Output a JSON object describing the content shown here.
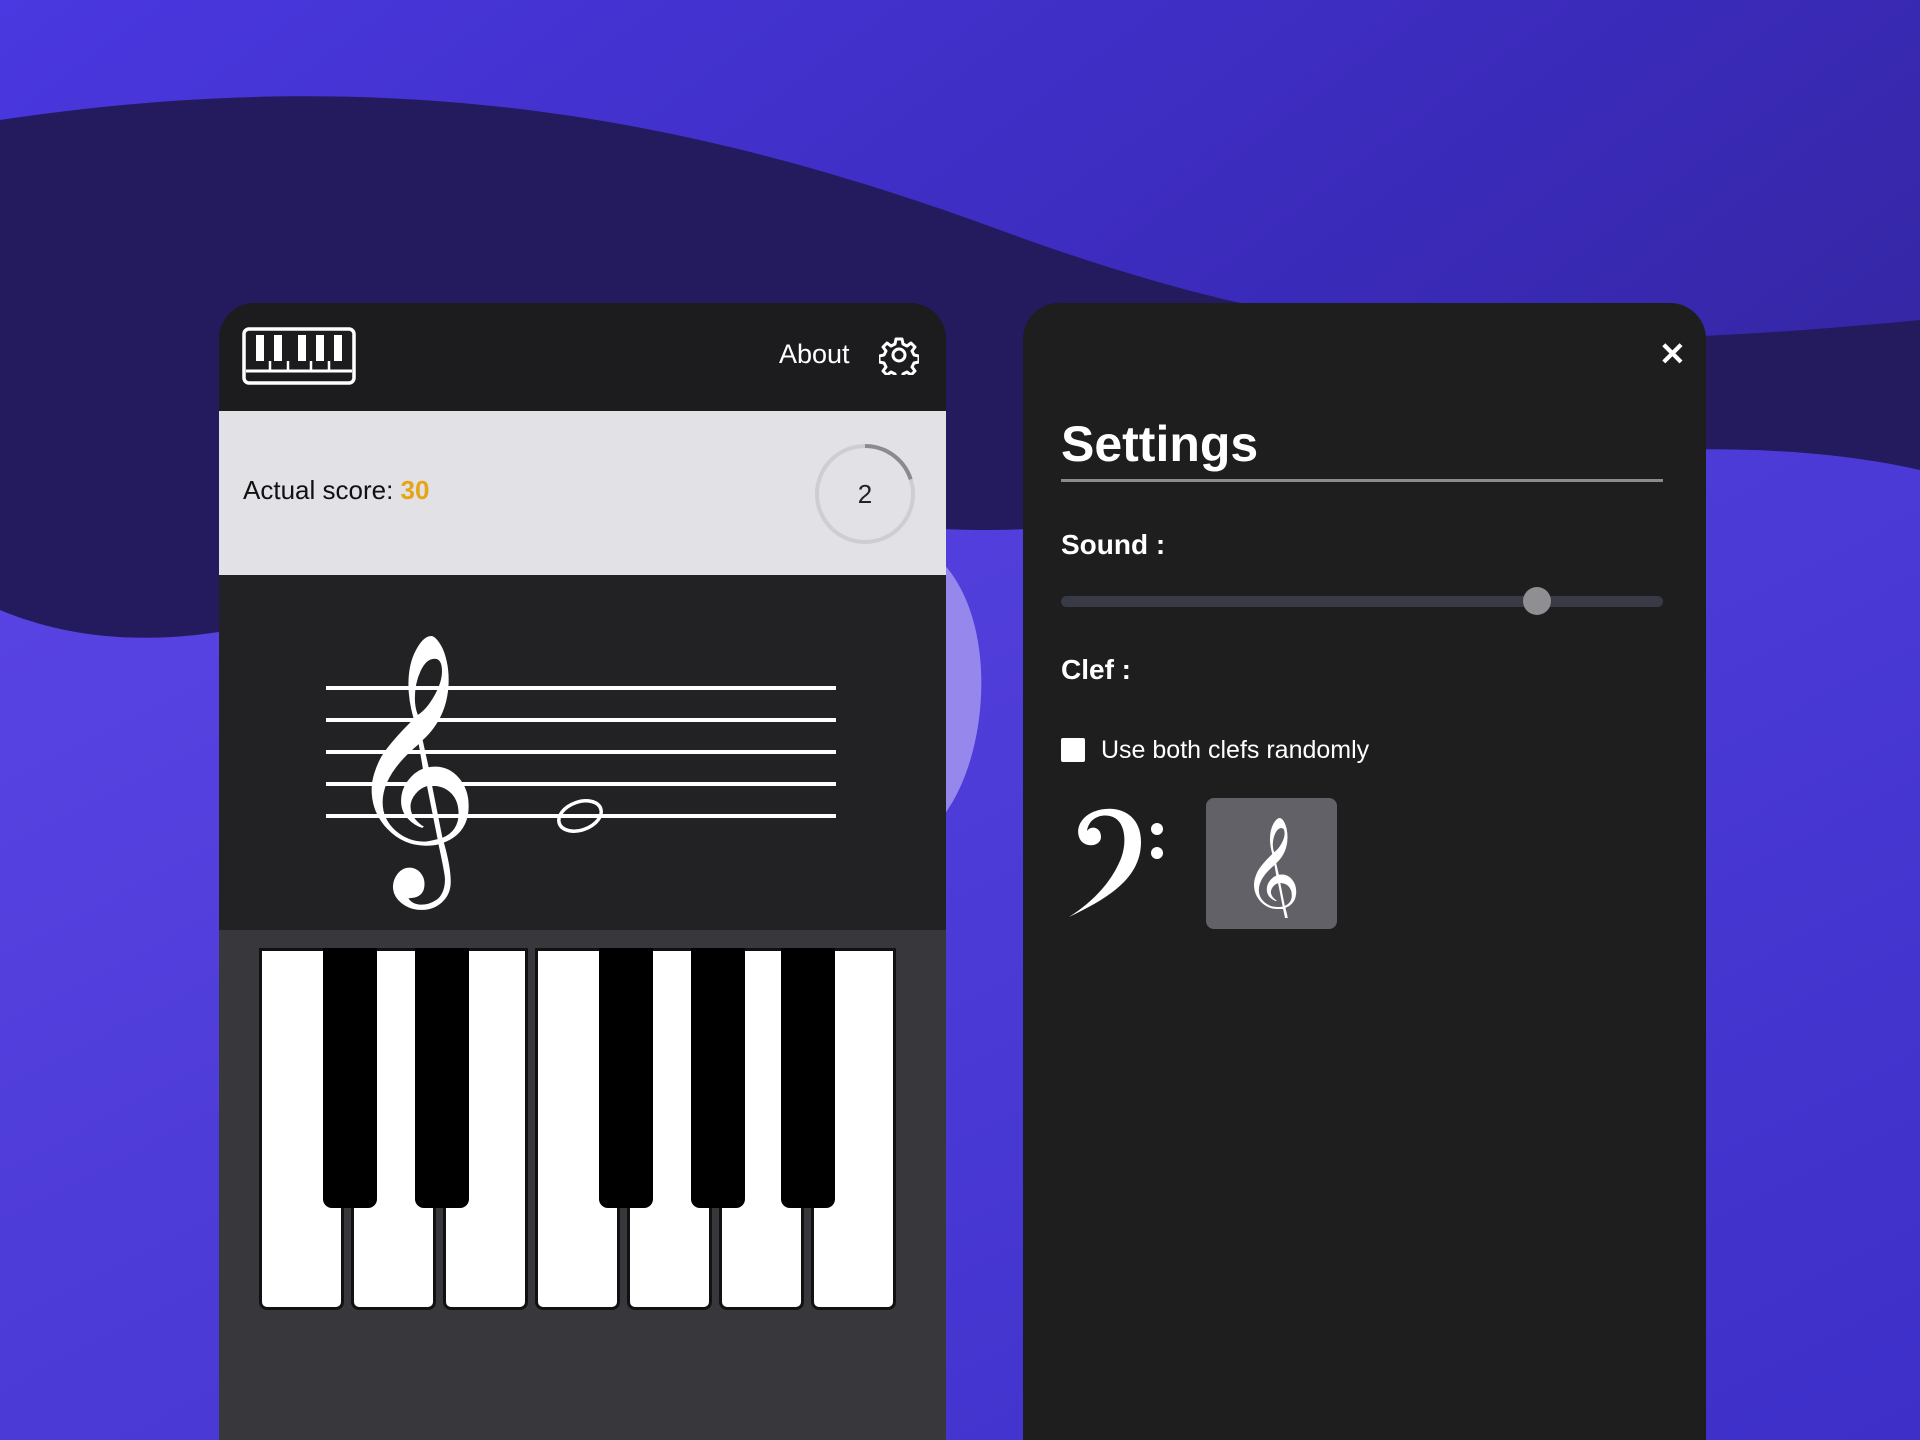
{
  "app": {
    "nav": {
      "about_label": "About"
    },
    "score": {
      "label": "Actual score: ",
      "value": "30"
    },
    "timer": {
      "value": "2",
      "progress": 0.2
    },
    "staff": {
      "clef": "treble",
      "note": "whole note"
    },
    "keyboard": {
      "white_keys": 7,
      "black_keys": 5
    }
  },
  "settings": {
    "title": "Settings",
    "close_label": "✕",
    "sound_label": "Sound :",
    "sound_level": 0.79,
    "clef_label": "Clef :",
    "random_clefs_label": "Use both clefs randomly",
    "random_clefs_checked": false,
    "clef_options": [
      "bass",
      "treble"
    ],
    "selected_clef": "treble"
  },
  "colors": {
    "score_accent": "#e6a515",
    "selected_clef_bg": "#626168"
  }
}
